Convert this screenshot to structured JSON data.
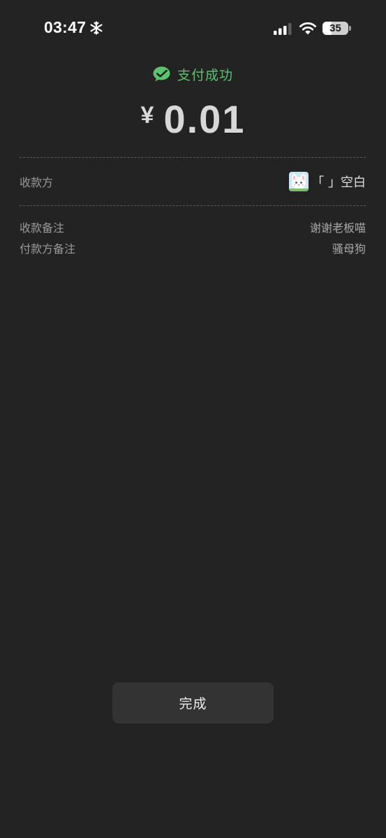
{
  "status_bar": {
    "time": "03:47",
    "battery_level": "35",
    "battery_fraction": 0.35,
    "icons": [
      "snowflake-icon",
      "cellular-signal-icon",
      "wifi-icon",
      "battery-icon"
    ]
  },
  "header": {
    "success_text": "支付成功",
    "currency_symbol": "¥",
    "amount": "0.01",
    "accent_color": "#5cc26e"
  },
  "payee": {
    "label": "收款方",
    "name": "「  」空白"
  },
  "notes": [
    {
      "label": "收款备注",
      "value": "谢谢老板喵"
    },
    {
      "label": "付款方备注",
      "value": "骚母狗"
    }
  ],
  "done_button": {
    "label": "完成"
  },
  "colors": {
    "background": "#232323",
    "button_background": "#333333"
  }
}
